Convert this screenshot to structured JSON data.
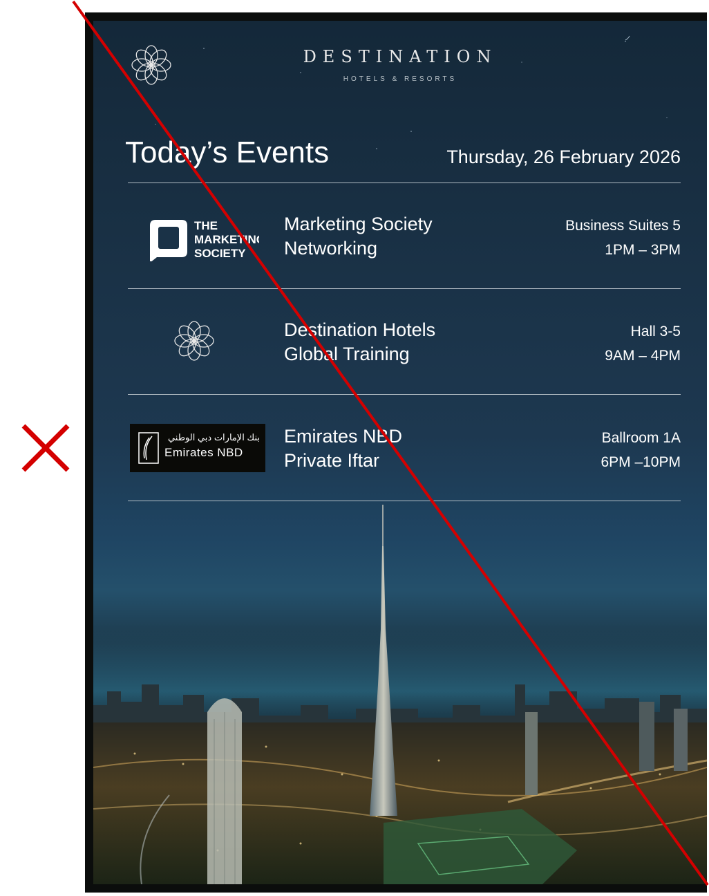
{
  "brand": {
    "name": "DESTINATION",
    "subtitle": "HOTELS & RESORTS",
    "logo_icon": "flower-icon"
  },
  "header": {
    "title": "Today’s Events",
    "date": "Thursday, 26 February 2026"
  },
  "events": [
    {
      "logo": "the-marketing-society-logo",
      "logo_text": [
        "THE",
        "MARKETING",
        "SOCIETY"
      ],
      "name_line1": "Marketing Society",
      "name_line2": "Networking",
      "venue": "Business Suites 5",
      "time": "1PM – 3PM"
    },
    {
      "logo": "flower-icon",
      "name_line1": "Destination Hotels",
      "name_line2": "Global Training",
      "venue": "Hall 3-5",
      "time": "9AM – 4PM"
    },
    {
      "logo": "emirates-nbd-logo",
      "logo_text_ar": "بنك الإمارات دبي الوطني",
      "logo_text_en": "Emirates NBD",
      "name_line1": "Emirates NBD",
      "name_line2": "Private Iftar",
      "venue": "Ballroom 1A",
      "time": "6PM –10PM"
    }
  ],
  "annotations": {
    "strike_color": "#d40000",
    "reject_icon": "cross-icon"
  },
  "colors": {
    "screen_top": "#142839",
    "text": "#ffffff",
    "frame": "#0b0d0c"
  }
}
